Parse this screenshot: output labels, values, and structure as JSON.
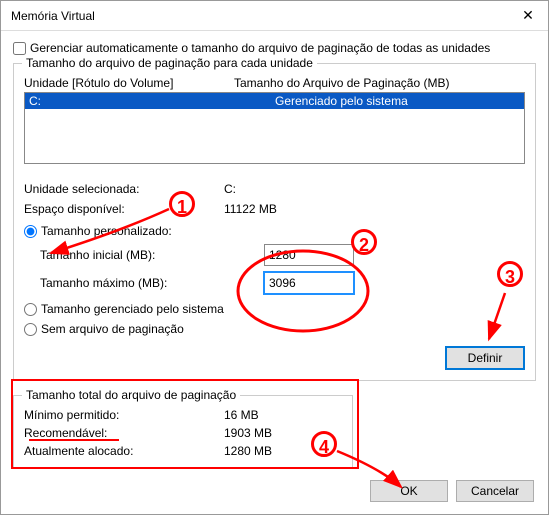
{
  "window": {
    "title": "Memória Virtual"
  },
  "auto_manage": {
    "label": "Gerenciar automaticamente o tamanho do arquivo de paginação de todas as unidades"
  },
  "drive_section": {
    "legend": "Tamanho do arquivo de paginação para cada unidade",
    "col1": "Unidade [Rótulo do Volume]",
    "col2": "Tamanho do Arquivo de Paginação (MB)",
    "items": [
      {
        "drive": "C:",
        "status": "Gerenciado pelo sistema"
      }
    ]
  },
  "selected": {
    "drive_label": "Unidade selecionada:",
    "drive_value": "C:",
    "space_label": "Espaço disponível:",
    "space_value": "11122 MB"
  },
  "options": {
    "custom": "Tamanho personalizado:",
    "initial_label": "Tamanho inicial (MB):",
    "initial_value": "1280",
    "max_label": "Tamanho máximo (MB):",
    "max_value": "3096",
    "system_managed": "Tamanho gerenciado pelo sistema",
    "no_file": "Sem arquivo de paginação",
    "set_button": "Definir"
  },
  "totals": {
    "legend": "Tamanho total do arquivo de paginação",
    "min_label": "Mínimo permitido:",
    "min_value": "16 MB",
    "rec_label": "Recomendável:",
    "rec_value": "1903 MB",
    "cur_label": "Atualmente alocado:",
    "cur_value": "1280 MB"
  },
  "footer": {
    "ok": "OK",
    "cancel": "Cancelar"
  },
  "annotations": {
    "n1": "1",
    "n2": "2",
    "n3": "3",
    "n4": "4"
  }
}
